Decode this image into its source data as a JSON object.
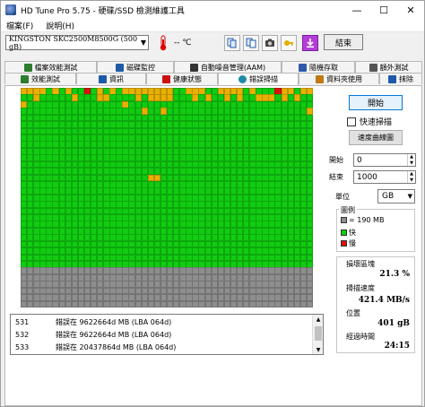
{
  "window": {
    "title": "HD Tune Pro 5.75 - 硬碟/SSD 檢測維護工具"
  },
  "menu": {
    "file": "檔案(F)",
    "help": "說明(H)"
  },
  "toolbar": {
    "drive": "KINGSTON SKC2500M8500G (500 gB)",
    "temperature": "-- ℃",
    "exit_label": "結束"
  },
  "tabs_top": [
    {
      "label": "檔案效能測試",
      "icon_color": "#2d7d2d"
    },
    {
      "label": "磁碟監控",
      "icon_color": "#1e5aa8"
    },
    {
      "label": "自動噪音管理(AAM)",
      "icon_color": "#333333"
    },
    {
      "label": "隨機存取",
      "icon_color": "#2d5aa8"
    },
    {
      "label": "額外測試",
      "icon_color": "#555555"
    }
  ],
  "tabs_bottom": [
    {
      "label": "效能測試",
      "icon_color": "#2d7d2d"
    },
    {
      "label": "資訊",
      "icon_color": "#1e5aa8"
    },
    {
      "label": "健康狀態",
      "icon_color": "#cc1111"
    },
    {
      "label": "錯誤掃描",
      "icon_color": "#1e8aa8"
    },
    {
      "label": "資料夾使用",
      "icon_color": "#c07a10"
    },
    {
      "label": "抹除",
      "icon_color": "#1e5aa8"
    }
  ],
  "scan": {
    "grid": {
      "columns": 46,
      "rows": 33,
      "green_rows": 27,
      "gray_rows": 6
    },
    "colors": {
      "ok": "#11cc11",
      "warn": "#e8b000",
      "bad": "#dd1111",
      "pending": "#8e8e8e"
    }
  },
  "log": [
    {
      "id": "531",
      "text": "錯誤在 9622664d MB (LBA 064d)"
    },
    {
      "id": "532",
      "text": "錯誤在 9622664d MB (LBA 064d)"
    },
    {
      "id": "533",
      "text": "錯誤在 20437864d MB (LBA 064d)"
    }
  ],
  "controls": {
    "start_label": "開始",
    "quick_scan_label": "快速掃描",
    "speed_map_label": "速度曲線圖",
    "start_field_label": "開始",
    "start_value": "0",
    "end_field_label": "結束",
    "end_value": "1000",
    "unit_label": "單位",
    "unit_value": "GB"
  },
  "legend": {
    "title": "圖例",
    "items": [
      {
        "label": "= 190 MB",
        "color": "#8e8e8e"
      },
      {
        "label": "快",
        "color": "#11cc11"
      },
      {
        "label": "慢",
        "color": "#dd1111"
      }
    ]
  },
  "stats": {
    "damaged_label": "損壞區塊",
    "damaged_value": "21.3 %",
    "speed_label": "掃描速度",
    "speed_value": "421.4 MB/s",
    "position_label": "位置",
    "position_value": "401 gB",
    "elapsed_label": "經過時間",
    "elapsed_value": "24:15"
  }
}
